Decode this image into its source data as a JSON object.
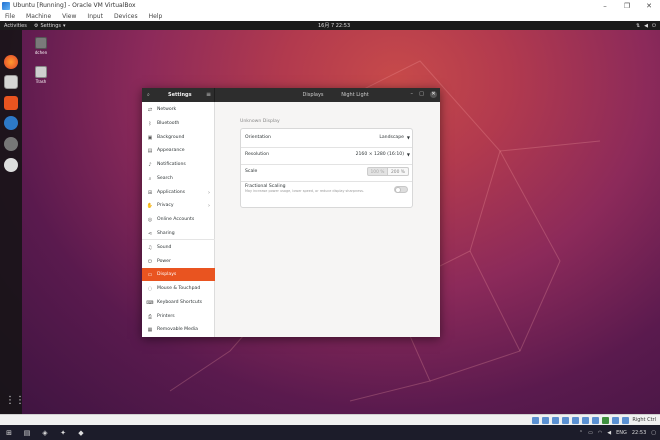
{
  "vbox": {
    "title": "Ubuntu [Running] - Oracle VM VirtualBox",
    "menu": [
      "File",
      "Machine",
      "View",
      "Input",
      "Devices",
      "Help"
    ],
    "status_right": "Right Ctrl"
  },
  "topbar": {
    "activities": "Activities",
    "app": "Settings",
    "clock": "16月 7  22:53"
  },
  "desktop": {
    "icons": [
      {
        "label": "dchen"
      },
      {
        "label": "Trash"
      }
    ]
  },
  "settings": {
    "title": "Settings",
    "tabs": [
      "Displays",
      "Night Light"
    ],
    "sidebar": [
      {
        "label": "Network",
        "icon": "network-icon"
      },
      {
        "label": "Bluetooth",
        "icon": "bluetooth-icon"
      },
      {
        "label": "Background",
        "icon": "background-icon"
      },
      {
        "label": "Appearance",
        "icon": "appearance-icon"
      },
      {
        "label": "Notifications",
        "icon": "bell-icon"
      },
      {
        "label": "Search",
        "icon": "search-icon"
      },
      {
        "label": "Applications",
        "icon": "apps-icon",
        "chevron": true
      },
      {
        "label": "Privacy",
        "icon": "hand-icon",
        "chevron": true
      },
      {
        "label": "Online Accounts",
        "icon": "accounts-icon"
      },
      {
        "label": "Sharing",
        "icon": "share-icon"
      },
      {
        "label": "Sound",
        "icon": "music-icon"
      },
      {
        "label": "Power",
        "icon": "power-icon"
      },
      {
        "label": "Displays",
        "icon": "display-icon",
        "active": true
      },
      {
        "label": "Mouse & Touchpad",
        "icon": "mouse-icon"
      },
      {
        "label": "Keyboard Shortcuts",
        "icon": "keyboard-icon"
      },
      {
        "label": "Printers",
        "icon": "printer-icon"
      },
      {
        "label": "Removable Media",
        "icon": "media-icon"
      }
    ],
    "display": {
      "heading": "Unknown Display",
      "orientation_label": "Orientation",
      "orientation_value": "Landscape",
      "resolution_label": "Resolution",
      "resolution_value": "2160 × 1280 (16:10)",
      "scale_label": "Scale",
      "scale_options": [
        "100 %",
        "200 %"
      ],
      "scale_selected": "100 %",
      "fractional_label": "Fractional Scaling",
      "fractional_sub": "May increase power usage, lower speed, or reduce display sharpness.",
      "fractional_on": false
    }
  },
  "taskbar": {
    "lang": "ENG",
    "time": "22:53"
  },
  "colors": {
    "accent": "#e95420",
    "headerbar": "#2d2d2d",
    "dock": "#1b1b1b"
  }
}
